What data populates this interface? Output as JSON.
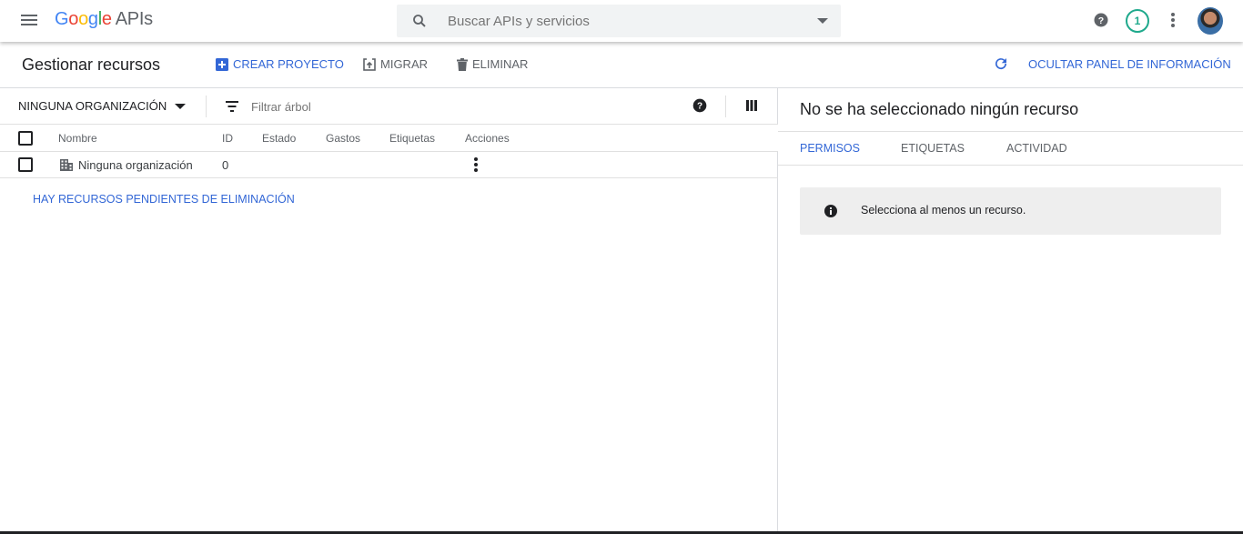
{
  "topbar": {
    "logo_google": [
      "G",
      "o",
      "o",
      "g",
      "l",
      "e"
    ],
    "logo_apis": "APIs",
    "search_placeholder": "Buscar APIs y servicios",
    "notification_count": "1"
  },
  "actionbar": {
    "page_title": "Gestionar recursos",
    "create_label": "CREAR PROYECTO",
    "migrate_label": "MIGRAR",
    "delete_label": "ELIMINAR",
    "hide_panel_label": "OCULTAR PANEL DE INFORMACIÓN"
  },
  "filterbar": {
    "org_label": "NINGUNA ORGANIZACIÓN",
    "filter_placeholder": "Filtrar árbol"
  },
  "table": {
    "headers": [
      "Nombre",
      "ID",
      "Estado",
      "Gastos",
      "Etiquetas",
      "Acciones"
    ],
    "rows": [
      {
        "name": "Ninguna organización",
        "id": "0",
        "estado": "",
        "gastos": "",
        "etiquetas": ""
      }
    ]
  },
  "pending_link": "HAY RECURSOS PENDIENTES DE ELIMINACIÓN",
  "info_panel": {
    "title": "No se ha seleccionado ningún recurso",
    "tabs": [
      {
        "label": "PERMISOS",
        "active": true
      },
      {
        "label": "ETIQUETAS",
        "active": false
      },
      {
        "label": "ACTIVIDAD",
        "active": false
      }
    ],
    "message": "Selecciona al menos un recurso."
  },
  "colors": {
    "accent": "#3367d6",
    "notification_ring": "#1fa98c",
    "text_muted": "#5f6368"
  }
}
